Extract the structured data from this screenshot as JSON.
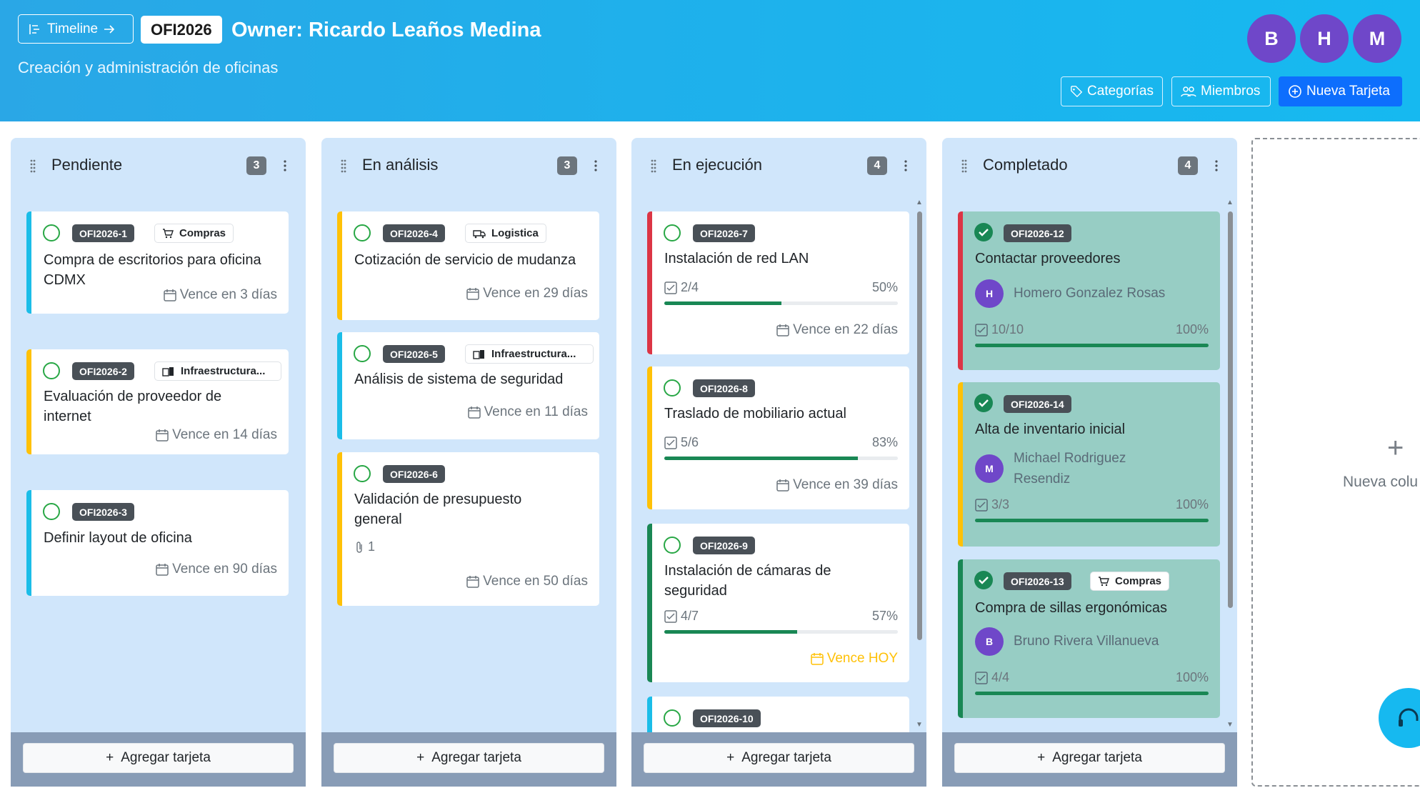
{
  "header": {
    "timeline_label": "Timeline",
    "project_code": "OFI2026",
    "owner": "Owner: Ricardo Leaños Medina",
    "subtitle": "Creación y administración de oficinas",
    "avatars": [
      "B",
      "H",
      "M"
    ],
    "buttons": {
      "categories": "Categorías",
      "members": "Miembros",
      "new_card": "Nueva Tarjeta"
    }
  },
  "columns": [
    {
      "title": "Pendiente",
      "count": "3",
      "add_label": "Agregar tarjeta",
      "cards": [
        {
          "code": "OFI2026-1",
          "tag": "Compras",
          "title": "Compra de escritorios para oficina CDMX",
          "due": "Vence en 3 días",
          "accent": "#1bbde8"
        },
        {
          "code": "OFI2026-2",
          "tag": "Infraestructura...",
          "title": "Evaluación de proveedor de internet",
          "due": "Vence en 14 días",
          "accent": "#ffc107"
        },
        {
          "code": "OFI2026-3",
          "title": "Definir layout de oficina",
          "due": "Vence en 90 días",
          "accent": "#1bbde8"
        }
      ]
    },
    {
      "title": "En análisis",
      "count": "3",
      "add_label": "Agregar tarjeta",
      "cards": [
        {
          "code": "OFI2026-4",
          "tag": "Logistica",
          "title": "Cotización de servicio de mudanza",
          "due": "Vence en 29 días",
          "accent": "#ffc107"
        },
        {
          "code": "OFI2026-5",
          "tag": "Infraestructura...",
          "title": "Análisis de sistema de seguridad",
          "due": "Vence en 11 días",
          "accent": "#1bbde8"
        },
        {
          "code": "OFI2026-6",
          "title": "Validación de presupuesto general",
          "attachments": "1",
          "due": "Vence en 50 días",
          "accent": "#ffc107"
        }
      ]
    },
    {
      "title": "En ejecución",
      "count": "4",
      "add_label": "Agregar tarjeta",
      "cards": [
        {
          "code": "OFI2026-7",
          "title": "Instalación de red LAN",
          "subtasks": "2/4",
          "percent": "50%",
          "progress": 0.5,
          "due": "Vence en 22 días",
          "accent": "#dc3545"
        },
        {
          "code": "OFI2026-8",
          "title": "Traslado de mobiliario actual",
          "subtasks": "5/6",
          "percent": "83%",
          "progress": 0.83,
          "due": "Vence en 39 días",
          "accent": "#ffc107"
        },
        {
          "code": "OFI2026-9",
          "title": "Instalación de cámaras de seguridad",
          "subtasks": "4/7",
          "percent": "57%",
          "progress": 0.57,
          "due": "Vence HOY",
          "accent": "#198754"
        },
        {
          "code": "OFI2026-10",
          "accent": "#1bbde8"
        }
      ]
    },
    {
      "title": "Completado",
      "count": "4",
      "add_label": "Agregar tarjeta",
      "cards": [
        {
          "code": "OFI2026-12",
          "title": "Contactar proveedores",
          "assignee_initial": "H",
          "assignee": "Homero Gonzalez Rosas",
          "subtasks": "10/10",
          "percent": "100%",
          "progress": 1.0,
          "accent": "#dc3545"
        },
        {
          "code": "OFI2026-14",
          "title": "Alta de inventario inicial",
          "assignee_initial": "M",
          "assignee": "Michael Rodriguez Resendiz",
          "subtasks": "3/3",
          "percent": "100%",
          "progress": 1.0,
          "accent": "#ffc107"
        },
        {
          "code": "OFI2026-13",
          "tag": "Compras",
          "title": "Compra de sillas ergonómicas",
          "assignee_initial": "B",
          "assignee": "Bruno Rivera Villanueva",
          "subtasks": "4/4",
          "percent": "100%",
          "progress": 1.0,
          "accent": "#198754"
        }
      ]
    }
  ],
  "new_column_label": "Nueva colu"
}
